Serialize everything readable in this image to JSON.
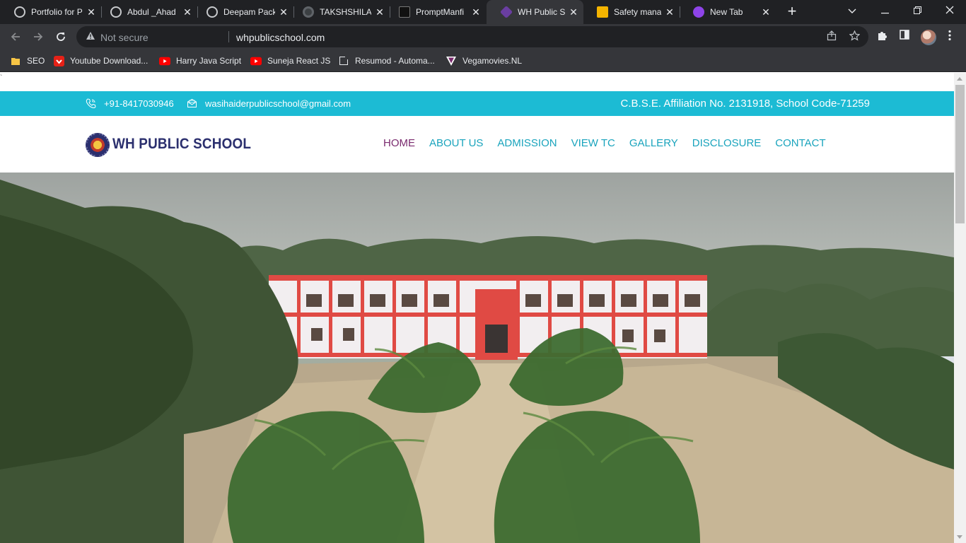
{
  "browser": {
    "tabs": [
      {
        "title": "Portfolio for Portfolio",
        "favicon": "globe-icon",
        "active": false
      },
      {
        "title": "Abdul _Ahad",
        "favicon": "globe-icon",
        "active": false
      },
      {
        "title": "Deepam Packaging",
        "favicon": "globe-icon",
        "active": false
      },
      {
        "title": "TAKSHSHILA",
        "favicon": "dot-icon",
        "active": false
      },
      {
        "title": "PromptManfi",
        "favicon": "prompt-icon",
        "active": false
      },
      {
        "title": "WH Public School",
        "favicon": "graduation-cap-icon",
        "active": true
      },
      {
        "title": "Safety management",
        "favicon": "slides-icon",
        "active": false
      },
      {
        "title": "New Tab",
        "favicon": "new-tab-icon",
        "active": false
      }
    ],
    "close_glyph": "✕",
    "new_tab_glyph": "+",
    "security_label": "Not secure",
    "url": "whpublicschool.com",
    "bookmarks": [
      {
        "label": "SEO",
        "icon": "folder-icon"
      },
      {
        "label": "Youtube Download...",
        "icon": "download-icon"
      },
      {
        "label": "Harry Java Script",
        "icon": "youtube-icon"
      },
      {
        "label": "Suneja React  JS",
        "icon": "youtube-icon"
      },
      {
        "label": "Resumod - Automa...",
        "icon": "page-icon"
      },
      {
        "label": "Vegamovies.NL",
        "icon": "vegamovies-icon"
      }
    ],
    "colors": {
      "tabbar": "#202124",
      "toolbar": "#35363a"
    }
  },
  "page": {
    "stray_char": "`",
    "topbar": {
      "phone": "+91-8417030946",
      "email": "wasihaiderpublicschool@gmail.com",
      "affiliation": "C.B.S.E. Affiliation No. 2131918, School Code-71259"
    },
    "logo_text": "WH PUBLIC SCHOOL",
    "nav": [
      {
        "label": "HOME",
        "active": true
      },
      {
        "label": "ABOUT US",
        "active": false
      },
      {
        "label": "ADMISSION",
        "active": false
      },
      {
        "label": "VIEW TC",
        "active": false
      },
      {
        "label": "GALLERY",
        "active": false
      },
      {
        "label": "DISCLOSURE",
        "active": false
      },
      {
        "label": "CONTACT",
        "active": false
      }
    ],
    "colors": {
      "topbar": "#1cbbd4",
      "nav_link": "#1aa4bd",
      "nav_active": "#7a2a6e",
      "logo": "#2b2f6e"
    },
    "hero_alt": "Aerial view of school building with palm trees"
  }
}
